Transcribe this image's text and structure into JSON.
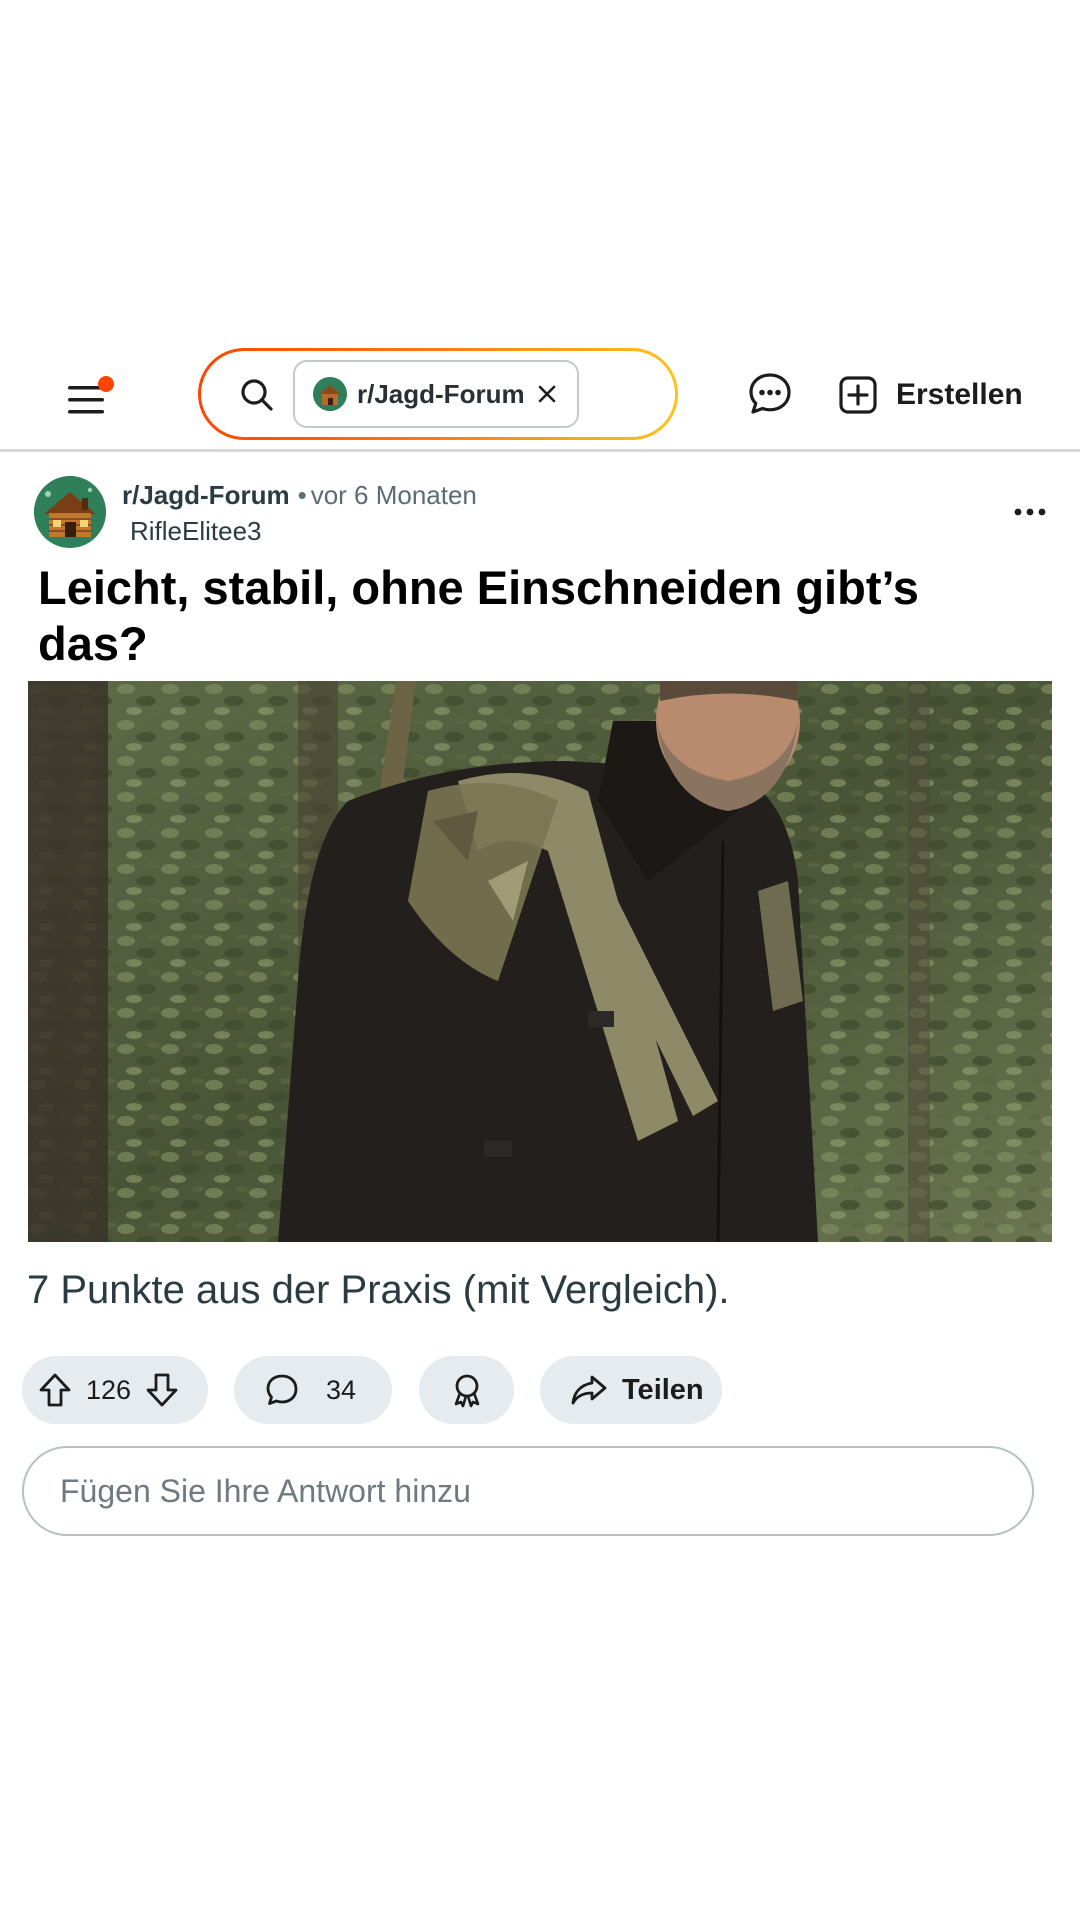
{
  "header": {
    "search_chip_label": "r/Jagd-Forum",
    "create_label": "Erstellen",
    "accent_color": "#ff4500",
    "icons": [
      "menu-icon",
      "search-icon",
      "close-icon",
      "chat-icon",
      "plus-square-icon"
    ]
  },
  "post": {
    "subreddit": "r/Jagd-Forum",
    "separator": "•",
    "time": "vor 6 Monaten",
    "author": "RifleElitee3",
    "title": "Leicht, stabil, ohne Einschneiden gibt’s das?",
    "body": "7 Punkte aus der Praxis (mit Vergleich).",
    "image_alt": "Jäger mit Rucksack und Gewehr im Wald"
  },
  "actions": {
    "votes": "126",
    "comments": "34",
    "share_label": "Teilen",
    "icons": [
      "upvote-icon",
      "downvote-icon",
      "comment-icon",
      "award-icon",
      "share-icon"
    ]
  },
  "reply": {
    "placeholder": "Fügen Sie Ihre Antwort hinzu"
  }
}
